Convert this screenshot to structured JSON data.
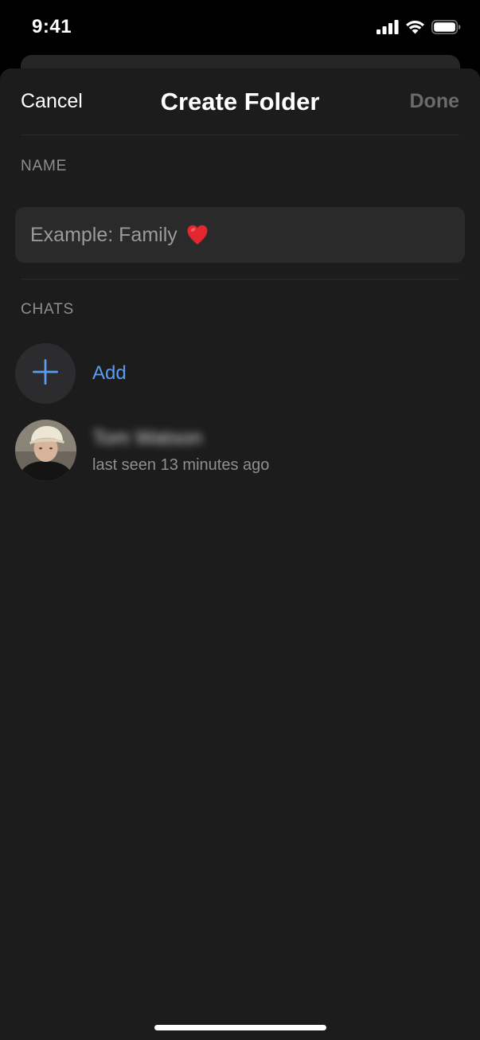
{
  "status_bar": {
    "time": "9:41",
    "icons": [
      "cellular-signal-icon",
      "wifi-icon",
      "battery-icon"
    ]
  },
  "nav": {
    "cancel_label": "Cancel",
    "title": "Create Folder",
    "done_label": "Done"
  },
  "name_section": {
    "label": "NAME",
    "placeholder": "Example: Family",
    "placeholder_emoji_icon": "red-heart-icon"
  },
  "chats_section": {
    "label": "CHATS",
    "add_label": "Add",
    "chats": [
      {
        "name": "Tom Watson",
        "status": "last seen 13 minutes ago"
      }
    ]
  },
  "colors": {
    "background": "#000000",
    "sheet": "#1c1c1c",
    "field": "#2a2a2a",
    "accent": "#5a9cf0",
    "secondary_text": "#8e8e93",
    "done_disabled": "#6b6b6b"
  }
}
